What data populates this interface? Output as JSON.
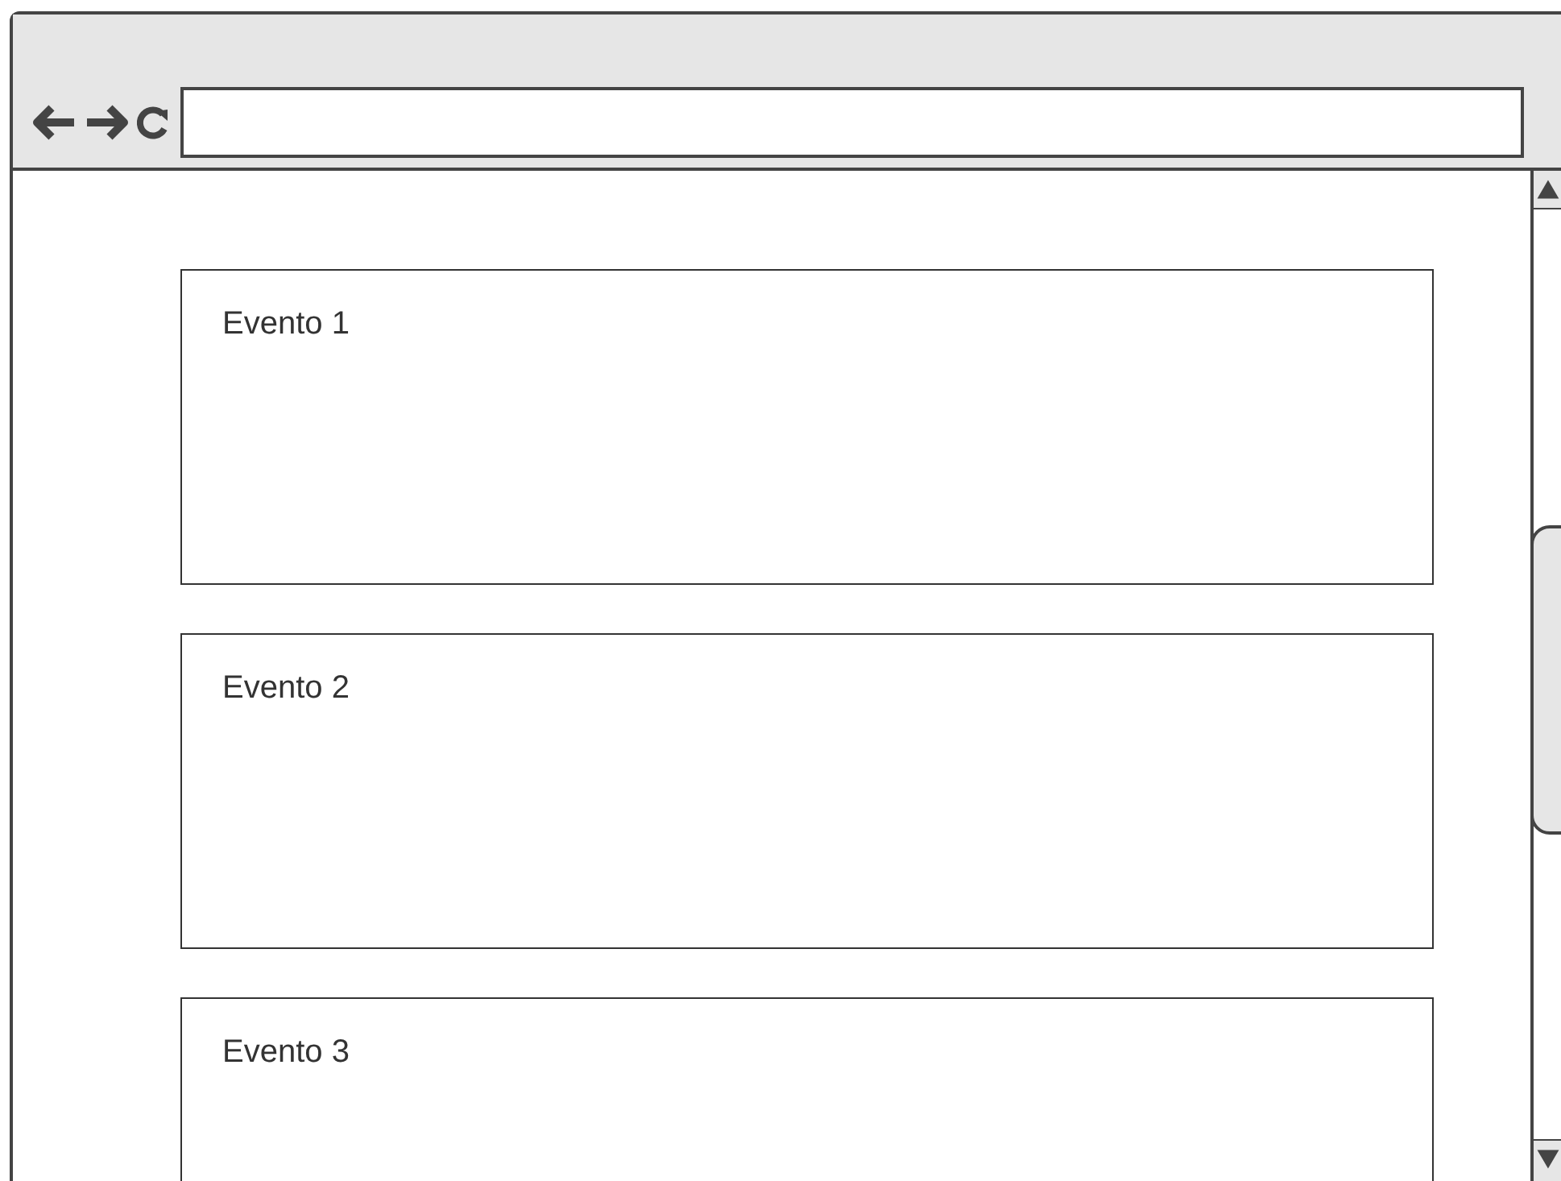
{
  "events": [
    {
      "title": "Evento 1"
    },
    {
      "title": "Evento 2"
    },
    {
      "title": "Evento 3"
    }
  ]
}
